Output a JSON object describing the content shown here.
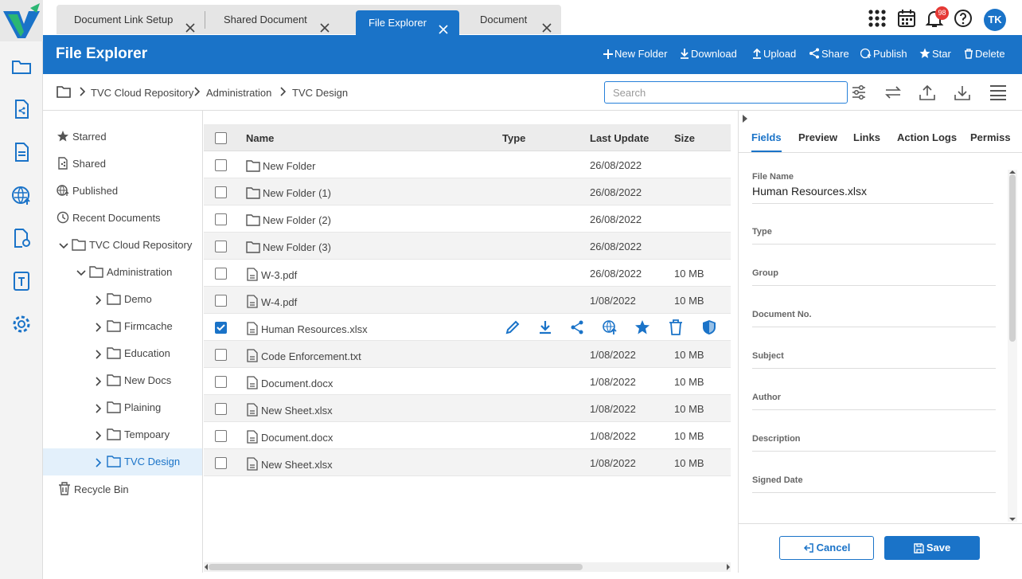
{
  "tabs": [
    {
      "label": "Document Link Setup"
    },
    {
      "label": "Shared Document"
    },
    {
      "label": "File Explorer"
    },
    {
      "label": "Document"
    }
  ],
  "notifications": {
    "count": "98"
  },
  "user": {
    "initials": "TK"
  },
  "header": {
    "title": "File Explorer",
    "actions": {
      "new_folder": "New Folder",
      "download": "Download",
      "upload": "Upload",
      "share": "Share",
      "publish": "Publish",
      "star": "Star",
      "delete": "Delete"
    }
  },
  "breadcrumb": [
    "TVC Cloud Repository",
    "Administration",
    "TVC Design"
  ],
  "search": {
    "placeholder": "Search"
  },
  "tree": {
    "starred": "Starred",
    "shared": "Shared",
    "published": "Published",
    "recent": "Recent Documents",
    "root": "TVC Cloud Repository",
    "admin": "Administration",
    "children": [
      "Demo",
      "Firmcache",
      "Education",
      "New Docs",
      "Plaining",
      "Tempoary",
      "TVC Design"
    ],
    "recycle": "Recycle Bin"
  },
  "table": {
    "columns": {
      "name": "Name",
      "type": "Type",
      "updated": "Last Update",
      "size": "Size"
    },
    "rows": [
      {
        "name": "New Folder",
        "kind": "folder",
        "date": "26/08/2022",
        "size": ""
      },
      {
        "name": "New Folder (1)",
        "kind": "folder",
        "date": "26/08/2022",
        "size": ""
      },
      {
        "name": "New Folder (2)",
        "kind": "folder",
        "date": "26/08/2022",
        "size": ""
      },
      {
        "name": "New Folder (3)",
        "kind": "folder",
        "date": "26/08/2022",
        "size": ""
      },
      {
        "name": "W-3.pdf",
        "kind": "file",
        "date": "26/08/2022",
        "size": "10 MB"
      },
      {
        "name": "W-4.pdf",
        "kind": "file",
        "date": "1/08/2022",
        "size": "10 MB"
      },
      {
        "name": "Human Resources.xlsx",
        "kind": "file",
        "date": "",
        "size": "",
        "selected": true
      },
      {
        "name": "Code Enforcement.txt",
        "kind": "file",
        "date": "1/08/2022",
        "size": "10 MB"
      },
      {
        "name": "Document.docx",
        "kind": "file",
        "date": "1/08/2022",
        "size": "10 MB"
      },
      {
        "name": "New Sheet.xlsx",
        "kind": "file",
        "date": "1/08/2022",
        "size": "10 MB"
      },
      {
        "name": "Document.docx",
        "kind": "file",
        "date": "1/08/2022",
        "size": "10 MB"
      },
      {
        "name": "New Sheet.xlsx",
        "kind": "file",
        "date": "1/08/2022",
        "size": "10 MB"
      }
    ]
  },
  "panel": {
    "tabs": [
      "Fields",
      "Preview",
      "Links",
      "Action Logs",
      "Permiss"
    ],
    "fields": [
      {
        "label": "File Name",
        "value": "Human Resources.xlsx"
      },
      {
        "label": "Type",
        "value": ""
      },
      {
        "label": "Group",
        "value": ""
      },
      {
        "label": "Document No.",
        "value": ""
      },
      {
        "label": "Subject",
        "value": ""
      },
      {
        "label": "Author",
        "value": ""
      },
      {
        "label": "Description",
        "value": ""
      },
      {
        "label": "Signed Date",
        "value": ""
      }
    ],
    "cancel": "Cancel",
    "save": "Save"
  },
  "colors": {
    "accent": "#1a73c8",
    "selected_bg": "#e3f0fb",
    "badge": "#e53935"
  }
}
